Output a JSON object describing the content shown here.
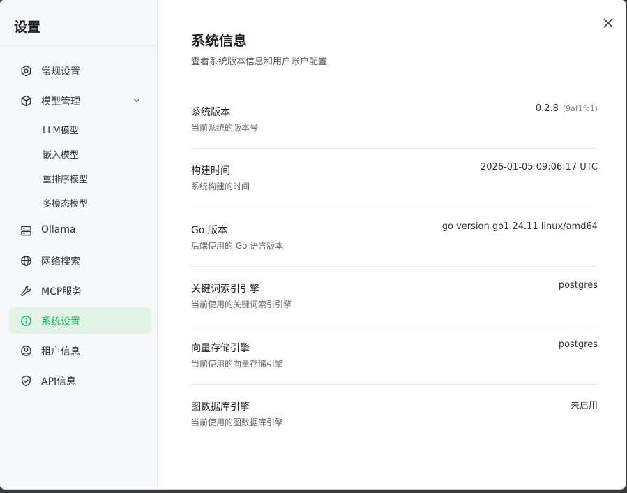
{
  "sidebar": {
    "title": "设置",
    "items": [
      {
        "label": "常规设置",
        "icon": "settings-hexagon-icon"
      },
      {
        "label": "模型管理",
        "icon": "cube-icon"
      },
      {
        "label": "Ollama",
        "icon": "server-icon"
      },
      {
        "label": "网络搜索",
        "icon": "globe-icon"
      },
      {
        "label": "MCP服务",
        "icon": "wrench-icon"
      },
      {
        "label": "系统设置",
        "icon": "info-circle-icon",
        "active": true
      },
      {
        "label": "租户信息",
        "icon": "user-circle-icon"
      },
      {
        "label": "API信息",
        "icon": "shield-check-icon"
      }
    ],
    "model_subitems": [
      "LLM模型",
      "嵌入模型",
      "重排序模型",
      "多模态模型"
    ],
    "active_color": "#07b852"
  },
  "main": {
    "title": "系统信息",
    "subtitle": "查看系统版本信息和用户账户配置",
    "rows": [
      {
        "label": "系统版本",
        "desc": "当前系统的版本号",
        "value": "0.2.8",
        "hash": "(9af1fc1)"
      },
      {
        "label": "构建时间",
        "desc": "系统构建的时间",
        "value": "2026-01-05 09:06:17 UTC"
      },
      {
        "label": "Go 版本",
        "desc": "后端使用的 Go 语言版本",
        "value": "go version go1.24.11 linux/amd64"
      },
      {
        "label": "关键词索引引擎",
        "desc": "当前使用的关键词索引引擎",
        "value": "postgres"
      },
      {
        "label": "向量存储引擎",
        "desc": "当前使用的向量存储引擎",
        "value": "postgres"
      },
      {
        "label": "图数据库引擎",
        "desc": "当前使用的图数据库引擎",
        "value": "未启用"
      }
    ]
  }
}
